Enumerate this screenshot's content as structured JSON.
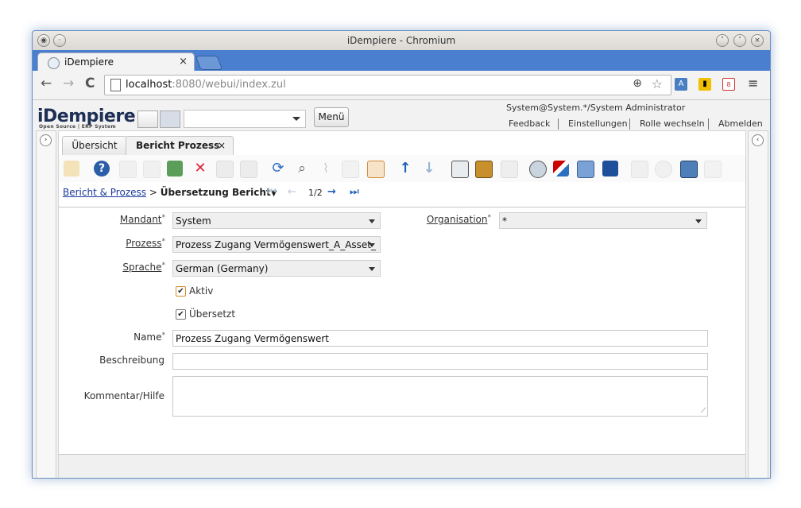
{
  "window": {
    "title": "iDempiere - Chromium"
  },
  "browser": {
    "tab_title": "iDempiere",
    "tab_close": "×",
    "url_host": "localhost",
    "url_rest": ":8080/webui/index.zul"
  },
  "header": {
    "logo": "iDempiere",
    "logo_sub": "Open Source | ERP System",
    "menu_label": "Menü",
    "user": "System@System.*/System Administrator",
    "links": [
      "Feedback",
      "Einstellungen",
      "Rolle wechseln",
      "Abmelden"
    ]
  },
  "tabs": {
    "overview": "Übersicht",
    "active": "Bericht Prozess",
    "close": "×"
  },
  "breadcrumb": {
    "link": "Bericht & Prozess",
    "sep": ">",
    "current": "Übersetzung Bericht",
    "record": "1/2"
  },
  "form": {
    "mandant_label": "Mandant",
    "mandant_value": "System",
    "org_label": "Organisation",
    "org_value": "*",
    "prozess_label": "Prozess",
    "prozess_value": "Prozess Zugang Vermögenswert_A_Asset_",
    "sprache_label": "Sprache",
    "sprache_value": "German (Germany)",
    "aktiv_label": "Aktiv",
    "aktiv_checked": true,
    "uebersetzt_label": "Übersetzt",
    "uebersetzt_checked": true,
    "name_label": "Name",
    "name_value": "Prozess Zugang Vermögenswert",
    "beschreibung_label": "Beschreibung",
    "beschreibung_value": "",
    "kommentar_label": "Kommentar/Hilfe",
    "kommentar_value": "",
    "required_mark": "*"
  },
  "icons": {
    "toolbar": [
      "undo-icon",
      "help-icon",
      "new-icon",
      "copy-icon",
      "delete-icon",
      "delete-selection-icon",
      "save-icon",
      "save-new-icon",
      "refresh-icon",
      "find-icon",
      "attachment-icon",
      "chat-icon",
      "grid-toggle-icon",
      "previous-record-icon",
      "next-record-icon",
      "report-icon",
      "archive-icon",
      "print-icon",
      "zoom-across-icon",
      "requests-icon",
      "product-info-icon",
      "active-workflows-icon",
      "process-icon",
      "lock-icon",
      "export-icon",
      "customize-icon"
    ]
  },
  "colors": {
    "accent": "#3a73c8",
    "link": "#1a3a9a"
  }
}
